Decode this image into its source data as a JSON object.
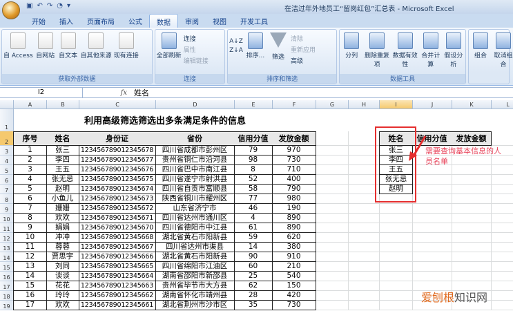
{
  "window": {
    "title": "在洁过年外地员工“留岗红包”汇总表 - Microsoft Excel",
    "qat": [
      "save-icon",
      "undo-icon",
      "redo-icon",
      "preview-icon"
    ]
  },
  "tabs": [
    "开始",
    "插入",
    "页面布局",
    "公式",
    "数据",
    "审阅",
    "视图",
    "开发工具"
  ],
  "active_tab": "数据",
  "ribbon": {
    "get_external": {
      "label": "获取外部数据",
      "buttons": [
        "自 Access",
        "自网站",
        "自文本",
        "自其他来源",
        "现有连接"
      ]
    },
    "connections": {
      "label": "连接",
      "big": "全部刷新",
      "small": [
        "连接",
        "属性",
        "编辑链接"
      ]
    },
    "sort_filter": {
      "label": "排序和筛选",
      "sort": "排序...",
      "filter": "筛选",
      "small": [
        "清除",
        "重新应用",
        "高级"
      ]
    },
    "data_tools": {
      "label": "数据工具",
      "buttons": [
        "分列",
        "删除重复项",
        "数据有效性",
        "合并计算",
        "假设分析"
      ]
    },
    "outline": {
      "buttons": [
        "组合",
        "取消组合"
      ]
    }
  },
  "formula_bar": {
    "name_box": "I2",
    "fx": "fx",
    "value": "姓名"
  },
  "columns": [
    "A",
    "B",
    "C",
    "D",
    "E",
    "F",
    "G",
    "H",
    "I",
    "J",
    "K",
    "L"
  ],
  "selected_column": "I",
  "sheet": {
    "title": "利用高级筛选筛选出多条满足条件的信息",
    "headers": [
      "序号",
      "姓名",
      "身份证",
      "省份",
      "信用分值",
      "发放金额"
    ],
    "rows": [
      [
        "1",
        "张三",
        "123456789012345678",
        "四川省成都市彭州区",
        "79",
        "970"
      ],
      [
        "2",
        "李四",
        "123456789012345677",
        "贵州省铜仁市沿河县",
        "98",
        "730"
      ],
      [
        "3",
        "王五",
        "123456789012345676",
        "四川省巴中市南江县",
        "8",
        "710"
      ],
      [
        "4",
        "张无忌",
        "123456789012345675",
        "四川省遂宁市射洪县",
        "52",
        "400"
      ],
      [
        "5",
        "赵明",
        "123456789012345674",
        "四川省自贡市富顺县",
        "58",
        "790"
      ],
      [
        "6",
        "小鱼儿",
        "123456789012345673",
        "陕西省铜川市耀州区",
        "77",
        "980"
      ],
      [
        "7",
        "姗姗",
        "123456789012345672",
        "山东省济宁市",
        "46",
        "190"
      ],
      [
        "8",
        "欢欢",
        "123456789012345671",
        "四川省达州市通川区",
        "4",
        "890"
      ],
      [
        "9",
        "娟娟",
        "123456789012345670",
        "四川省德阳市中江县",
        "61",
        "890"
      ],
      [
        "10",
        "冲冲",
        "123456789012345668",
        "湖北省黄石市阳新县",
        "59",
        "620"
      ],
      [
        "11",
        "蓉蓉",
        "123456789012345667",
        "四川省达州市渠县",
        "14",
        "380"
      ],
      [
        "12",
        "贾思宇",
        "123456789012345666",
        "湖北省黄石市阳新县",
        "90",
        "910"
      ],
      [
        "13",
        "刘同",
        "123456789012345665",
        "四川省绵阳市江油区",
        "60",
        "210"
      ],
      [
        "14",
        "谈谈",
        "123456789012345664",
        "湖南省邵阳市新邵县",
        "25",
        "540"
      ],
      [
        "15",
        "花花",
        "123456789012345663",
        "贵州省毕节市大方县",
        "62",
        "150"
      ],
      [
        "16",
        "玲玲",
        "123456789012345662",
        "湖南省怀化市靖州县",
        "28",
        "420"
      ],
      [
        "17",
        "欢欢",
        "123456789012345661",
        "湖北省荆州市沙市区",
        "35",
        "730"
      ]
    ],
    "criteria_headers": [
      "姓名",
      "信用分值",
      "发放金额"
    ],
    "criteria_names": [
      "张三",
      "李四",
      "王五",
      "张无忌",
      "赵明"
    ],
    "annotation": "需要查询基本信息的人员名单",
    "annotation_color": "#e8435a",
    "highlight_color": "#e52e2e"
  },
  "watermark": {
    "part1": "爱刨根",
    "part2": "知识网"
  }
}
